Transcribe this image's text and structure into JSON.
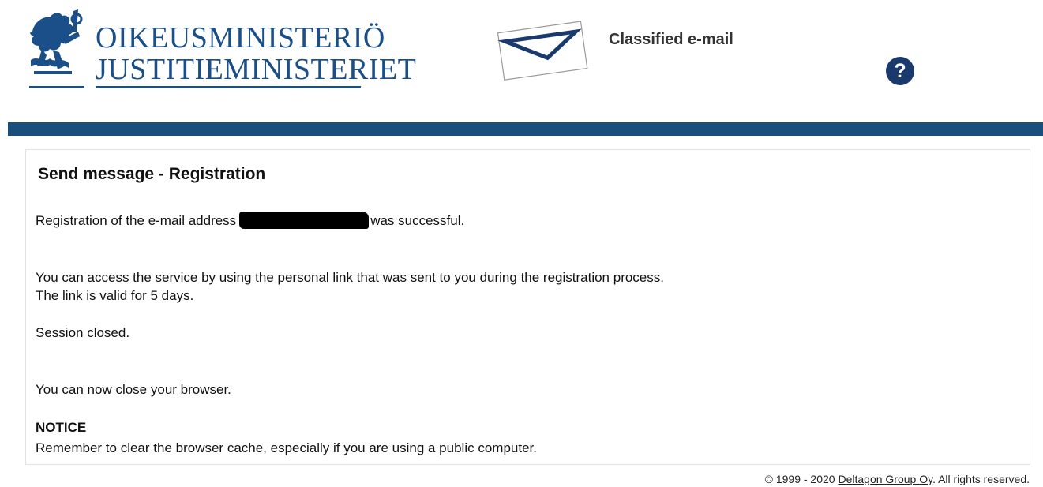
{
  "header": {
    "logo_line1": "OIKEUSMINISTERIÖ",
    "logo_line2": "JUSTITIEMINISTERIET",
    "logo_icon": "heraldic-lion-icon",
    "envelope_icon": "envelope-icon",
    "service_title": "Classified e-mail",
    "help_icon": "question-mark-icon",
    "help_label": "?"
  },
  "colors": {
    "brand_blue": "#1b4f8a",
    "bar_blue": "#1a4f7d",
    "help_blue": "#1a3a6e"
  },
  "main": {
    "heading": "Send message - Registration",
    "registration_prefix": "Registration of the e-mail address",
    "registration_suffix": "was successful.",
    "access_line1": "You can access the service by using the personal link that was sent to you during the registration process.",
    "access_line2": "The link is valid for 5 days.",
    "session_closed": "Session closed.",
    "close_browser": "You can now close your browser.",
    "notice_title": "NOTICE",
    "notice_text": "Remember to clear the browser cache, especially if you are using a public computer."
  },
  "footer": {
    "copyright_prefix": "© 1999 - 2020",
    "company_link": "Deltagon Group Oy",
    "copyright_suffix": ". All rights reserved."
  }
}
